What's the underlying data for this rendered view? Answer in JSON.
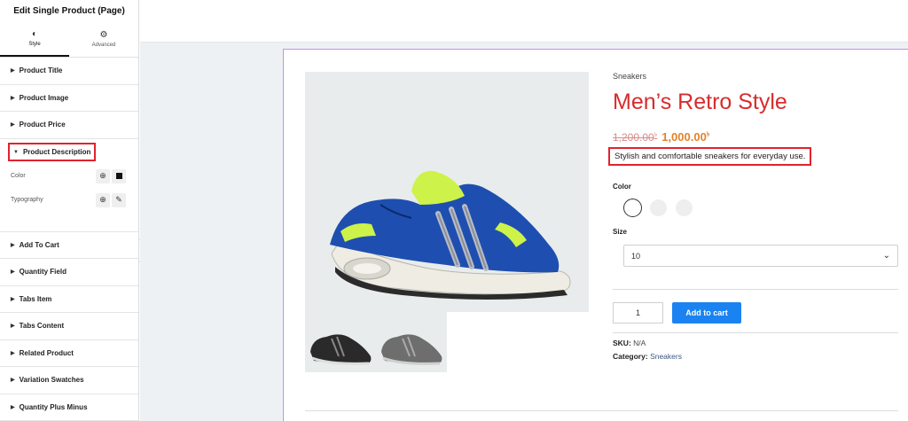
{
  "panel": {
    "title": "Edit Single Product (Page)",
    "tabs": [
      {
        "label": "Style",
        "icon": "half-circle-icon"
      },
      {
        "label": "Advanced",
        "icon": "gear-icon"
      }
    ],
    "sections": [
      "Product Title",
      "Product Image",
      "Product Price",
      "Product Description",
      "Add To Cart",
      "Quantity Field",
      "Tabs Item",
      "Tabs Content",
      "Related Product",
      "Variation Swatches",
      "Quantity Plus Minus"
    ],
    "open_section_index": 3,
    "controls": {
      "color_label": "Color",
      "color_value": "#111111",
      "typography_label": "Typography"
    }
  },
  "product": {
    "category": "Sneakers",
    "title": "Men’s Retro Style",
    "old_price": "1,200.00",
    "new_price": "1,000.00",
    "currency": "৳",
    "description": "Stylish and comfortable sneakers for everyday use.",
    "color_label": "Color",
    "size_label": "Size",
    "size_value": "10",
    "quantity": "1",
    "add_to_cart": "Add to cart",
    "sku_label": "SKU:",
    "sku_value": "N/A",
    "category_label": "Category:",
    "category_value": "Sneakers"
  },
  "colors": {
    "accent": "#1b83f1",
    "title_red": "#d82c2c",
    "price_orange": "#e4822a",
    "highlight": "#e0232d"
  }
}
